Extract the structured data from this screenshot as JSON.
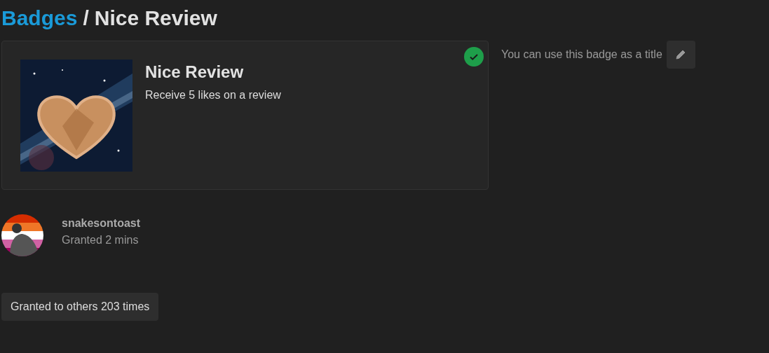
{
  "breadcrumb": {
    "parent": "Badges",
    "separator": "/",
    "current": "Nice Review"
  },
  "badge": {
    "name": "Nice Review",
    "description": "Receive 5 likes on a review",
    "granted": true
  },
  "title_note": {
    "text": "You can use this badge as a title",
    "edit_button": true
  },
  "grants": [
    {
      "user": "snakesontoast",
      "time": "Granted 2 mins"
    }
  ],
  "others_button": {
    "label": "Granted to others 203 times"
  }
}
